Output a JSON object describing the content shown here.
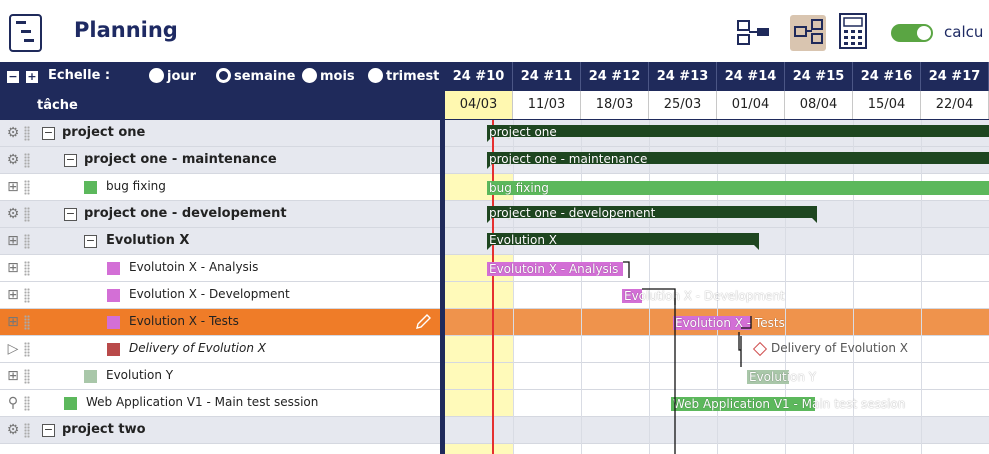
{
  "header": {
    "title": "Planning",
    "toggle_label": "calcu",
    "icons": [
      "planning-icon",
      "tree-view-icon",
      "gantt-view-icon",
      "calculator-icon"
    ]
  },
  "toolbar": {
    "collapse_all": "−",
    "expand_all": "+",
    "scale_label": "Echelle :",
    "options": [
      {
        "label": "jour",
        "selected": false
      },
      {
        "label": "semaine",
        "selected": true
      },
      {
        "label": "mois",
        "selected": false
      },
      {
        "label": "trimest",
        "selected": false
      }
    ]
  },
  "grid": {
    "column_header": "tâche"
  },
  "timeline": {
    "weeks": [
      "24 #10",
      "24 #11",
      "24 #12",
      "24 #13",
      "24 #14",
      "24 #15",
      "24 #16",
      "24 #17"
    ],
    "dates": [
      "04/03",
      "11/03",
      "18/03",
      "25/03",
      "01/04",
      "08/04",
      "15/04",
      "22/04"
    ]
  },
  "colors": {
    "navy": "#1f2a5b",
    "summary_bar": "#1e4620",
    "green": "#5cb85c",
    "violet": "#d36fd6",
    "delivery": "#b94a4a",
    "evolution_y": "#a9c7a9",
    "selected_row": "#ef7c28",
    "today_line": "#e53030"
  },
  "tasks": [
    {
      "label": "project one",
      "type": "project",
      "icon": "gear-icon",
      "level": 0,
      "bar_label": "project one",
      "color": "#1e4620"
    },
    {
      "label": "project one - maintenance",
      "type": "project",
      "icon": "gear-icon",
      "level": 1,
      "bar_label": "project one - maintenance",
      "color": "#1e4620"
    },
    {
      "label": "bug fixing",
      "type": "task",
      "icon": "task-icon",
      "level": 2,
      "bar_label": "bug fixing",
      "color": "#5cb85c"
    },
    {
      "label": "project one - developement",
      "type": "project",
      "icon": "gear-icon",
      "level": 1,
      "bar_label": "project one - developement",
      "color": "#1e4620"
    },
    {
      "label": "Evolution X",
      "type": "project",
      "icon": "task-icon",
      "level": 2,
      "bar_label": "Evolution X",
      "color": "#1e4620"
    },
    {
      "label": "Evolutoin X - Analysis",
      "type": "task",
      "icon": "task-icon",
      "level": 3,
      "bar_label": "Evolutoin X - Analysis",
      "color": "#d36fd6"
    },
    {
      "label": "Evolution X - Development",
      "type": "task",
      "icon": "task-icon",
      "level": 3,
      "bar_label": "Evolution X - Development",
      "color": "#d36fd6"
    },
    {
      "label": "Evolution X - Tests",
      "type": "task",
      "icon": "task-icon",
      "level": 3,
      "bar_label": "Evolution X - Tests",
      "color": "#d36fd6",
      "selected": true
    },
    {
      "label": "Delivery of Evolution X",
      "type": "milestone",
      "icon": "flag-icon",
      "level": 3,
      "bar_label": "Delivery of Evolution X",
      "color": "#b94a4a"
    },
    {
      "label": "Evolution Y",
      "type": "task",
      "icon": "task-icon",
      "level": 2,
      "bar_label": "Evolution Y",
      "color": "#a9c7a9"
    },
    {
      "label": "Web Application V1 - Main test session",
      "type": "task",
      "icon": "test-icon",
      "level": 1,
      "bar_label": "Web Application V1 - Main test session",
      "color": "#5cb85c"
    },
    {
      "label": "project two",
      "type": "project",
      "icon": "gear-icon",
      "level": 0,
      "bar_label": "",
      "color": "#1e4620"
    }
  ]
}
